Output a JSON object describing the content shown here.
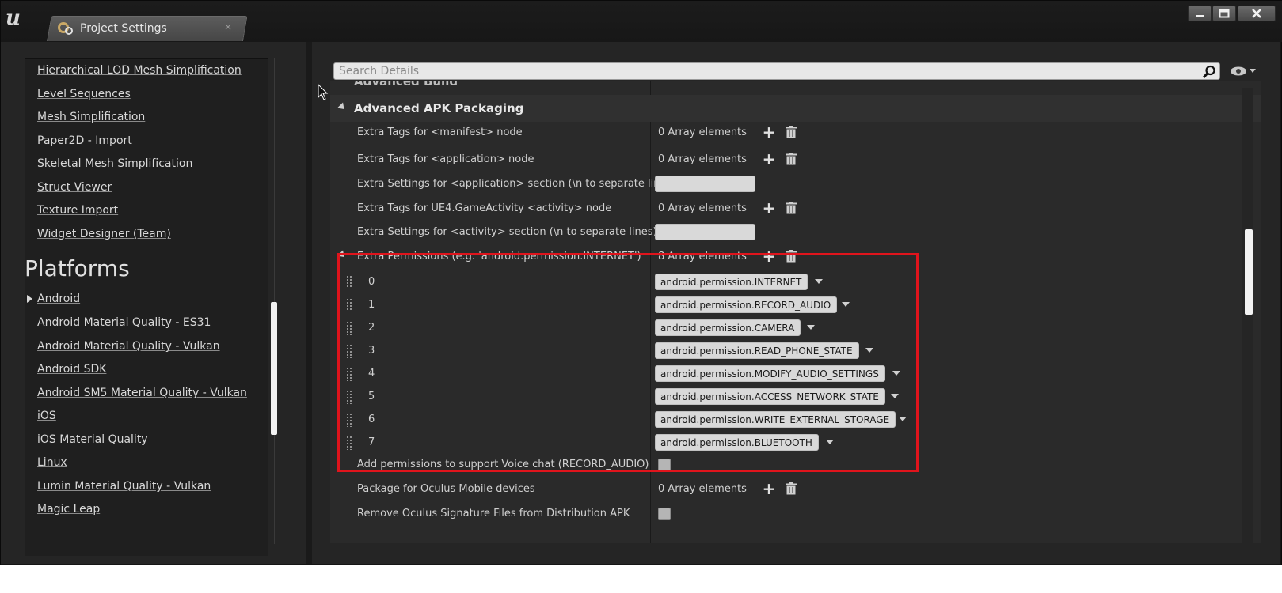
{
  "window": {
    "tab_title": "Project Settings",
    "tab_close": "×",
    "minimize": "▁",
    "maximize": "▭",
    "close": "✕"
  },
  "sidebar": {
    "items_top": [
      "Hierarchical LOD Mesh Simplification",
      "Level Sequences",
      "Mesh Simplification",
      "Paper2D - Import",
      "Skeletal Mesh Simplification",
      "Struct Viewer",
      "Texture Import",
      "Widget Designer (Team)"
    ],
    "platforms_heading": "Platforms",
    "platforms": [
      "Android",
      "Android Material Quality - ES31",
      "Android Material Quality - Vulkan",
      "Android SDK",
      "Android SM5 Material Quality - Vulkan",
      "iOS",
      "iOS Material Quality",
      "Linux",
      "Lumin Material Quality - Vulkan",
      "Magic Leap"
    ]
  },
  "search": {
    "placeholder": "Search Details"
  },
  "details": {
    "cut_off_category": "Advanced Build",
    "category": "Advanced APK Packaging",
    "rows": [
      {
        "label": "Extra Tags for <manifest> node",
        "value": "0 Array elements"
      },
      {
        "label": "Extra Tags for <application> node",
        "value": "0 Array elements"
      },
      {
        "label": "Extra Settings for <application> section (\\n to separate lines)",
        "value": ""
      },
      {
        "label": "Extra Tags for UE4.GameActivity <activity> node",
        "value": "0 Array elements"
      },
      {
        "label": "Extra Settings for <activity> section (\\n to separate lines)",
        "value": ""
      },
      {
        "label": "Extra Permissions (e.g. 'android.permission.INTERNET')",
        "value": "8 Array elements"
      }
    ],
    "permissions": [
      {
        "index": "0",
        "value": "android.permission.INTERNET"
      },
      {
        "index": "1",
        "value": "android.permission.RECORD_AUDIO"
      },
      {
        "index": "2",
        "value": "android.permission.CAMERA"
      },
      {
        "index": "3",
        "value": "android.permission.READ_PHONE_STATE"
      },
      {
        "index": "4",
        "value": "android.permission.MODIFY_AUDIO_SETTINGS"
      },
      {
        "index": "5",
        "value": "android.permission.ACCESS_NETWORK_STATE"
      },
      {
        "index": "6",
        "value": "android.permission.WRITE_EXTERNAL_STORAGE"
      },
      {
        "index": "7",
        "value": "android.permission.BLUETOOTH"
      }
    ],
    "rows_bottom": [
      {
        "label": "Add permissions to support Voice chat (RECORD_AUDIO)",
        "value": ""
      },
      {
        "label": "Package for Oculus Mobile devices",
        "value": "0 Array elements"
      },
      {
        "label": "Remove Oculus Signature Files from Distribution APK",
        "value": ""
      }
    ]
  },
  "colors": {
    "highlight": "#e0141c",
    "panel": "#2a2a2a",
    "field": "#d9d9d9"
  }
}
